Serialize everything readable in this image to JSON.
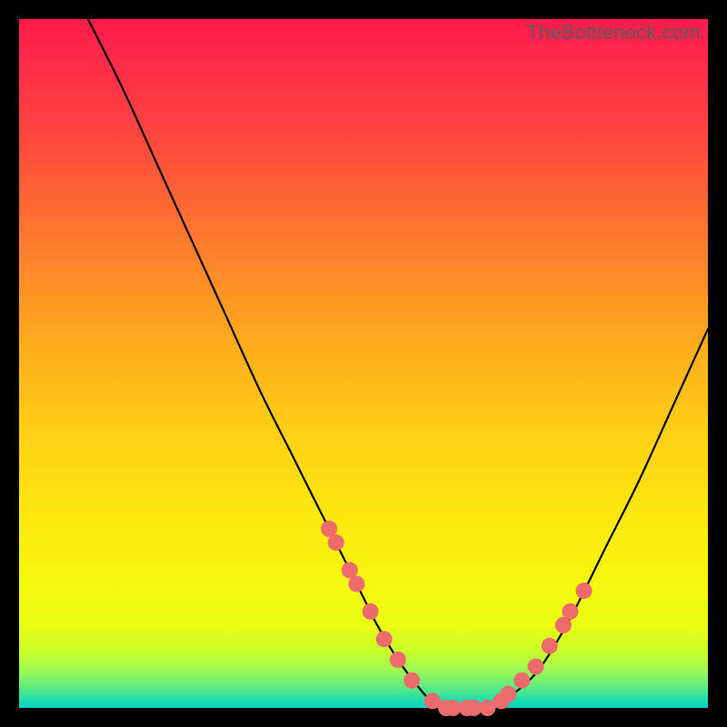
{
  "watermark": "TheBottleneck.com",
  "chart_data": {
    "type": "line",
    "title": "",
    "xlabel": "",
    "ylabel": "",
    "xlim": [
      0,
      100
    ],
    "ylim": [
      0,
      100
    ],
    "grid": false,
    "legend": false,
    "series": [
      {
        "name": "bottleneck-curve",
        "color": "#000000",
        "x": [
          10,
          15,
          20,
          25,
          30,
          35,
          40,
          45,
          50,
          52,
          55,
          58,
          60,
          63,
          66,
          70,
          75,
          80,
          85,
          90,
          95,
          100
        ],
        "y": [
          100,
          90,
          79,
          68,
          57,
          46,
          36,
          26,
          16,
          12,
          7,
          3,
          1,
          0,
          0,
          1,
          5,
          13,
          23,
          33,
          44,
          55
        ]
      }
    ],
    "markers": {
      "name": "highlight-dots",
      "color": "#ed6a6d",
      "points": [
        {
          "x": 45,
          "y": 26
        },
        {
          "x": 46,
          "y": 24
        },
        {
          "x": 48,
          "y": 20
        },
        {
          "x": 49,
          "y": 18
        },
        {
          "x": 51,
          "y": 14
        },
        {
          "x": 53,
          "y": 10
        },
        {
          "x": 55,
          "y": 7
        },
        {
          "x": 57,
          "y": 4
        },
        {
          "x": 60,
          "y": 1
        },
        {
          "x": 62,
          "y": 0
        },
        {
          "x": 63,
          "y": 0
        },
        {
          "x": 65,
          "y": 0
        },
        {
          "x": 66,
          "y": 0
        },
        {
          "x": 68,
          "y": 0
        },
        {
          "x": 70,
          "y": 1
        },
        {
          "x": 71,
          "y": 2
        },
        {
          "x": 73,
          "y": 4
        },
        {
          "x": 75,
          "y": 6
        },
        {
          "x": 77,
          "y": 9
        },
        {
          "x": 79,
          "y": 12
        },
        {
          "x": 80,
          "y": 14
        },
        {
          "x": 82,
          "y": 17
        }
      ]
    },
    "background_gradient": {
      "top": "#ff1a4d",
      "middle": "#ffd014",
      "bottom": "#05d1c4"
    }
  }
}
